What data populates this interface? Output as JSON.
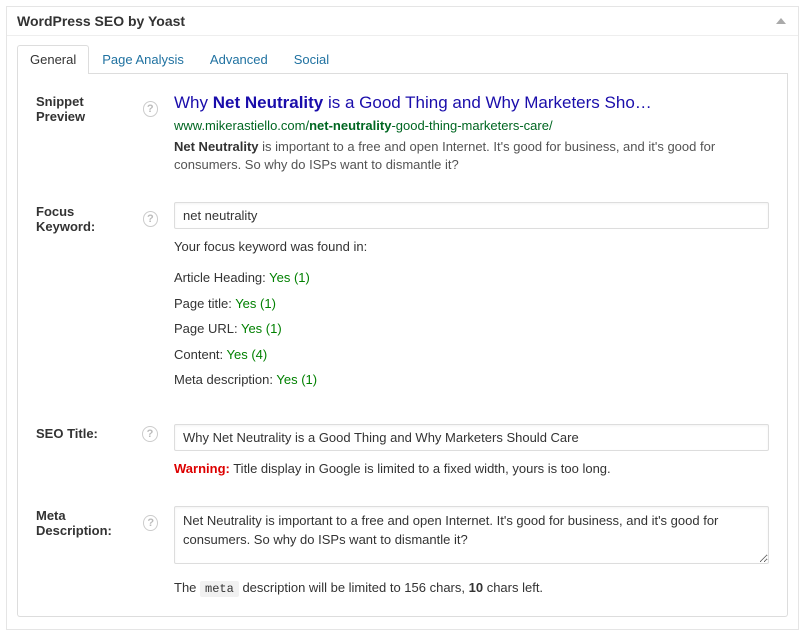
{
  "header": {
    "title": "WordPress SEO by Yoast"
  },
  "tabs": {
    "general": "General",
    "page_analysis": "Page Analysis",
    "advanced": "Advanced",
    "social": "Social"
  },
  "snippet": {
    "label": "Snippet Preview",
    "title_pre": "Why ",
    "title_bold": "Net Neutrality",
    "title_post": " is a Good Thing and Why Marketers Sho…",
    "url_pre": "www.mikerastiello.com/",
    "url_bold": "net-neutrality",
    "url_post": "-good-thing-marketers-care/",
    "desc_bold": "Net Neutrality",
    "desc_post": " is important to a free and open Internet. It's good for business, and it's good for consumers. So why do ISPs want to dismantle it?"
  },
  "focus": {
    "label": "Focus Keyword:",
    "value": "net neutrality",
    "found_intro": "Your focus keyword was found in:",
    "rows": {
      "article_heading_label": "Article Heading: ",
      "article_heading_val": "Yes (1)",
      "page_title_label": "Page title: ",
      "page_title_val": "Yes (1)",
      "page_url_label": "Page URL: ",
      "page_url_val": "Yes (1)",
      "content_label": "Content: ",
      "content_val": "Yes (4)",
      "meta_desc_label": "Meta description: ",
      "meta_desc_val": "Yes (1)"
    }
  },
  "seo_title": {
    "label": "SEO Title:",
    "value": "Why Net Neutrality is a Good Thing and Why Marketers Should Care",
    "warning_label": "Warning:",
    "warning_text": " Title display in Google is limited to a fixed width, yours is too long."
  },
  "meta_desc": {
    "label": "Meta Description:",
    "value": "Net Neutrality is important to a free and open Internet. It's good for business, and it's good for consumers. So why do ISPs want to dismantle it?",
    "hint_pre": "The ",
    "hint_code": "meta",
    "hint_mid": " description will be limited to 156 chars, ",
    "hint_count": "10",
    "hint_post": " chars left."
  }
}
